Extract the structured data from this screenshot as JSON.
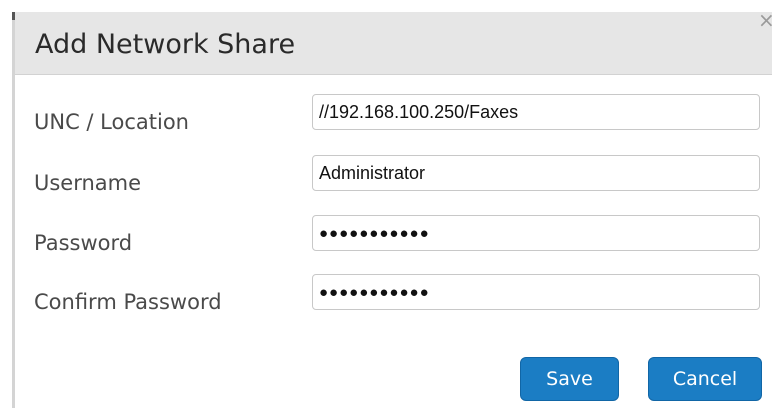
{
  "dialog": {
    "title": "Add Network Share",
    "close_glyph": "×",
    "close_icon": "close-icon"
  },
  "form": {
    "unc": {
      "label": "UNC / Location",
      "value": "//192.168.100.250/Faxes"
    },
    "username": {
      "label": "Username",
      "value": "Administrator"
    },
    "password": {
      "label": "Password",
      "value": "●●●●●●●●●●●"
    },
    "confirm_password": {
      "label": "Confirm Password",
      "value": "●●●●●●●●●●●"
    }
  },
  "buttons": {
    "save_label": "Save",
    "cancel_label": "Cancel"
  },
  "colors": {
    "header_bg": "#e6e6e6",
    "button_primary": "#1b7dc4",
    "label_text": "#4a4a4a"
  }
}
